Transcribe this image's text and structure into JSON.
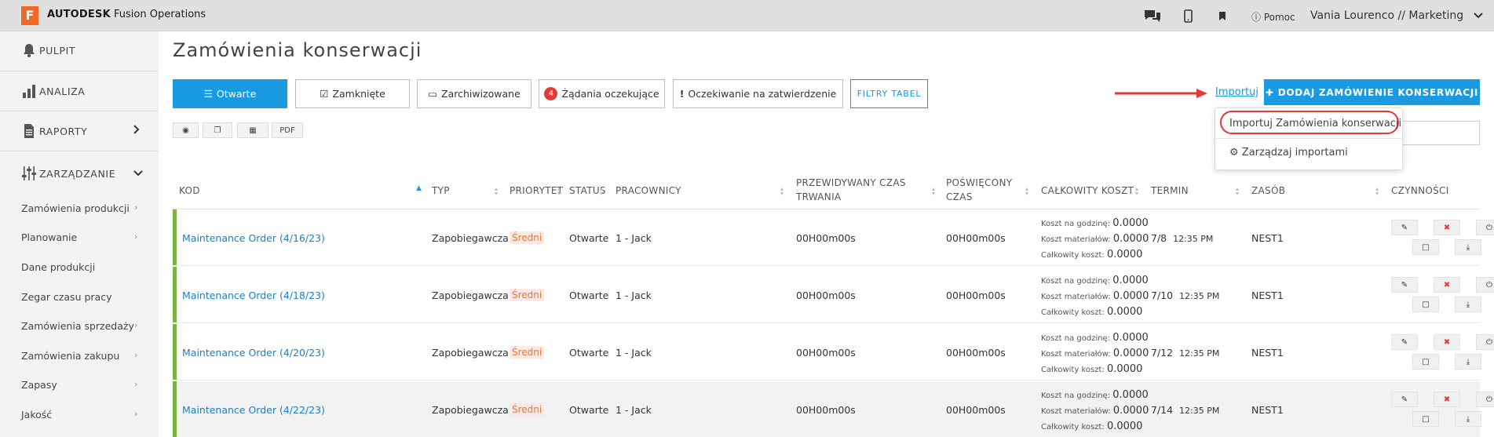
{
  "app": {
    "logo_letter": "F",
    "brand_bold": "AUTODESK",
    "brand_rest": " Fusion Operations"
  },
  "top": {
    "help": "Pomoc",
    "user": "Vania Lourenco // Marketing"
  },
  "sidebar": {
    "main": [
      {
        "label": "PULPIT"
      },
      {
        "label": "ANALIZA"
      },
      {
        "label": "RAPORTY"
      },
      {
        "label": "ZARZĄDZANIE"
      }
    ],
    "sub": [
      {
        "label": "Zamówienia produkcji",
        "chevron": true
      },
      {
        "label": "Planowanie",
        "chevron": true
      },
      {
        "label": "Dane produkcji",
        "chevron": false
      },
      {
        "label": "Zegar czasu pracy",
        "chevron": false
      },
      {
        "label": "Zamówienia sprzedaży",
        "chevron": true
      },
      {
        "label": "Zamówienia zakupu",
        "chevron": true
      },
      {
        "label": "Zapasy",
        "chevron": true
      },
      {
        "label": "Jakość",
        "chevron": true
      }
    ]
  },
  "page": {
    "title": "Zamówienia konserwacji"
  },
  "tabs": {
    "open": "Otwarte",
    "closed": "Zamknięte",
    "archived": "Zarchiwizowane",
    "pending_count": "4",
    "pending": "Żądania oczekujące",
    "awaiting": "Oczekiwanie na zatwierdzenie",
    "filters": "FILTRY TABEL"
  },
  "actions": {
    "import": "Importuj",
    "add": "DODAJ ZAMÓWIENIE KONSERWACJI",
    "pdf": "PDF"
  },
  "dropdown": {
    "import_orders": "Importuj Zamówienia konserwacji",
    "manage_imports": "Zarządzaj importami"
  },
  "columns": {
    "code": "KOD",
    "type": "TYP",
    "priority": "PRIORYTET",
    "status": "STATUS",
    "workers": "PRACOWNICY",
    "expected_1": "PRZEWIDYWANY CZAS",
    "expected_2": "TRWANIA",
    "spent_1": "POŚWIĘCONY",
    "spent_2": "CZAS",
    "total_cost": "CAŁKOWITY KOSZT",
    "due": "TERMIN",
    "resource": "ZASÓB",
    "actions": "CZYNNOŚCI"
  },
  "cost_labels": {
    "hourly": "Koszt na godzinę:",
    "material": "Koszt materiałów:",
    "total": "Całkowity koszt:"
  },
  "rows": [
    {
      "code": "Maintenance Order (4/16/23)",
      "type": "Zapobiegawcza",
      "priority": "Średni",
      "status": "Otwarte",
      "workers": "1 - Jack",
      "expected": "00H00m00s",
      "spent": "00H00m00s",
      "hourly": "0.0000",
      "material": "0.0000",
      "total": "0.0000",
      "due_date": "7/8",
      "due_time": "12:35 PM",
      "resource": "NEST1"
    },
    {
      "code": "Maintenance Order (4/18/23)",
      "type": "Zapobiegawcza",
      "priority": "Średni",
      "status": "Otwarte",
      "workers": "1 - Jack",
      "expected": "00H00m00s",
      "spent": "00H00m00s",
      "hourly": "0.0000",
      "material": "0.0000",
      "total": "0.0000",
      "due_date": "7/10",
      "due_time": "12:35 PM",
      "resource": "NEST1"
    },
    {
      "code": "Maintenance Order (4/20/23)",
      "type": "Zapobiegawcza",
      "priority": "Średni",
      "status": "Otwarte",
      "workers": "1 - Jack",
      "expected": "00H00m00s",
      "spent": "00H00m00s",
      "hourly": "0.0000",
      "material": "0.0000",
      "total": "0.0000",
      "due_date": "7/12",
      "due_time": "12:35 PM",
      "resource": "NEST1"
    },
    {
      "code": "Maintenance Order (4/22/23)",
      "type": "Zapobiegawcza",
      "priority": "Średni",
      "status": "Otwarte",
      "workers": "1 - Jack",
      "expected": "00H00m00s",
      "spent": "00H00m00s",
      "hourly": "0.0000",
      "material": "0.0000",
      "total": "0.0000",
      "due_date": "7/14",
      "due_time": "12:35 PM",
      "resource": "NEST1"
    }
  ],
  "colors": {
    "accent": "#1a9ae0",
    "row_bar": "#7cb342",
    "priority": "#e8782e",
    "highlight": "#e53935"
  }
}
